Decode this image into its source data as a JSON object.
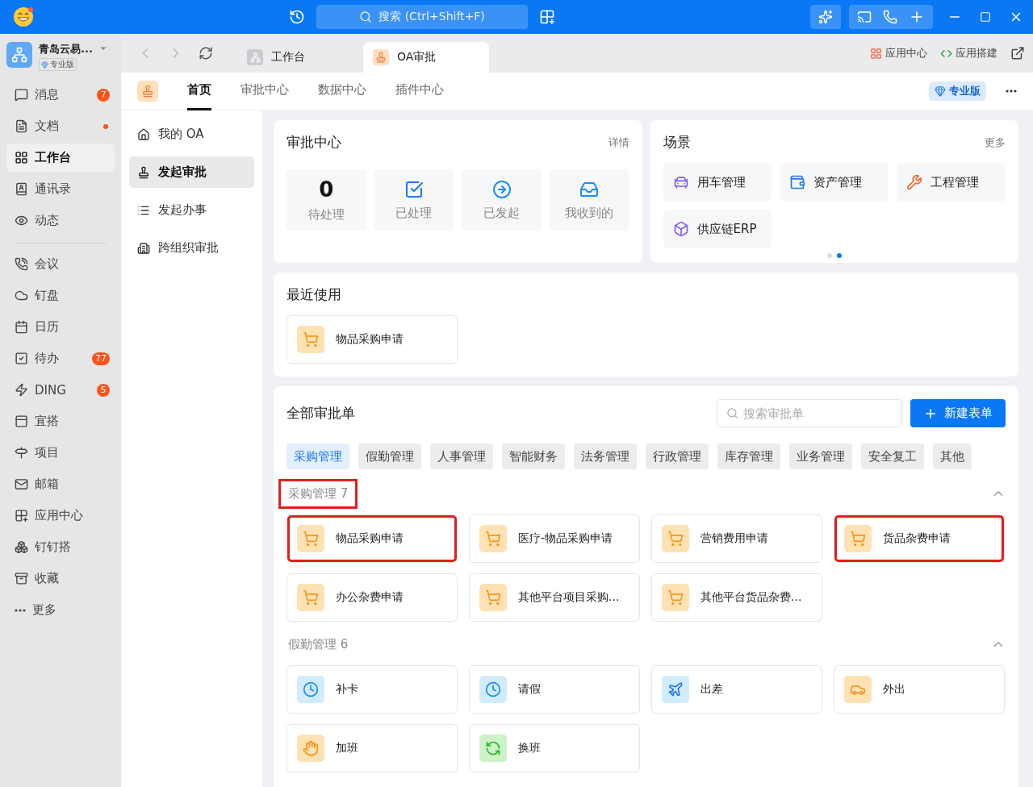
{
  "titlebar": {
    "search": {
      "placeholder": "搜索 (Ctrl+Shift+F)"
    }
  },
  "account": {
    "name": "青岛云易...",
    "plan": "专业版"
  },
  "sidebar": {
    "sections": [
      {
        "items": [
          {
            "label": "消息",
            "badge": "7",
            "dot": false,
            "selected": false
          },
          {
            "label": "文档",
            "dot": true,
            "selected": false
          },
          {
            "label": "工作台",
            "dot": false,
            "selected": true
          },
          {
            "label": "通讯录",
            "dot": false,
            "selected": false
          },
          {
            "label": "动态",
            "dot": false,
            "selected": false
          }
        ]
      },
      {
        "items": [
          {
            "label": "会议",
            "dot": false,
            "selected": false
          },
          {
            "label": "钉盘",
            "dot": false,
            "selected": false
          },
          {
            "label": "日历",
            "dot": false,
            "selected": false
          },
          {
            "label": "待办",
            "badge": "77",
            "dot": false,
            "selected": false
          },
          {
            "label": "DING",
            "badge": "5",
            "dot": false,
            "selected": false
          },
          {
            "label": "宜搭",
            "dot": false,
            "selected": false
          },
          {
            "label": "项目",
            "dot": false,
            "selected": false
          },
          {
            "label": "邮箱",
            "dot": false,
            "selected": false
          },
          {
            "label": "应用中心",
            "dot": false,
            "selected": false
          },
          {
            "label": "钉钉搭",
            "dot": false,
            "selected": false
          },
          {
            "label": "收藏",
            "dot": false,
            "selected": false
          },
          {
            "label": "更多",
            "dot": false,
            "selected": false
          }
        ]
      }
    ]
  },
  "browser_tabs": [
    {
      "label": "工作台",
      "selected": false
    },
    {
      "label": "OA审批",
      "selected": true
    }
  ],
  "toolbar_links": [
    "应用中心",
    "应用搭建"
  ],
  "subnav": {
    "tabs": [
      {
        "label": "首页",
        "selected": true
      },
      {
        "label": "审批中心",
        "selected": false
      },
      {
        "label": "数据中心",
        "selected": false
      },
      {
        "label": "插件中心",
        "selected": false
      }
    ],
    "plan_badge": "专业版"
  },
  "side_menu": [
    {
      "label": "我的 OA",
      "selected": false
    },
    {
      "label": "发起审批",
      "selected": true
    },
    {
      "label": "发起办事",
      "selected": false
    },
    {
      "label": "跨组织审批",
      "selected": false
    }
  ],
  "approval_center": {
    "title": "审批中心",
    "link": "详情",
    "stats": [
      {
        "kind": "count",
        "value": "0",
        "label": "待处理"
      },
      {
        "kind": "icon",
        "label": "已处理"
      },
      {
        "kind": "icon",
        "label": "已发起"
      },
      {
        "kind": "icon",
        "label": "我收到的"
      }
    ]
  },
  "scenes": {
    "title": "场景",
    "link": "更多",
    "items": [
      {
        "label": "用车管理"
      },
      {
        "label": "资产管理"
      },
      {
        "label": "工程管理"
      },
      {
        "label": "供应链ERP"
      }
    ],
    "pager": [
      {
        "selected": false
      },
      {
        "selected": true
      }
    ]
  },
  "recent": {
    "title": "最近使用",
    "items": [
      {
        "label": "物品采购申请"
      }
    ]
  },
  "all_forms": {
    "title": "全部审批单",
    "search": {
      "placeholder": "搜索审批单"
    },
    "new_button": "新建表单",
    "categories": [
      {
        "label": "采购管理",
        "selected": true
      },
      {
        "label": "假勤管理",
        "selected": false
      },
      {
        "label": "人事管理",
        "selected": false
      },
      {
        "label": "智能财务",
        "selected": false
      },
      {
        "label": "法务管理",
        "selected": false
      },
      {
        "label": "行政管理",
        "selected": false
      },
      {
        "label": "库存管理",
        "selected": false
      },
      {
        "label": "业务管理",
        "selected": false
      },
      {
        "label": "安全复工",
        "selected": false
      },
      {
        "label": "其他",
        "selected": false
      }
    ],
    "groups": [
      {
        "name": "采购管理",
        "count": "7",
        "highlighted": true,
        "expanded": true,
        "items": [
          {
            "label": "物品采购申请",
            "highlighted": true
          },
          {
            "label": "医疗-物品采购申请",
            "highlighted": false
          },
          {
            "label": "营销费用申请",
            "highlighted": false
          },
          {
            "label": "货品杂费申请",
            "highlighted": true
          },
          {
            "label": "办公杂费申请",
            "highlighted": false
          },
          {
            "label": "其他平台项目采购...",
            "highlighted": false
          },
          {
            "label": "其他平台货品杂费...",
            "highlighted": false
          }
        ]
      },
      {
        "name": "假勤管理",
        "count": "6",
        "highlighted": false,
        "expanded": true,
        "items": [
          {
            "label": "补卡",
            "highlighted": false
          },
          {
            "label": "请假",
            "highlighted": false
          },
          {
            "label": "出差",
            "highlighted": false
          },
          {
            "label": "外出",
            "highlighted": false
          },
          {
            "label": "加班",
            "highlighted": false
          },
          {
            "label": "换班",
            "highlighted": false
          }
        ]
      }
    ]
  }
}
